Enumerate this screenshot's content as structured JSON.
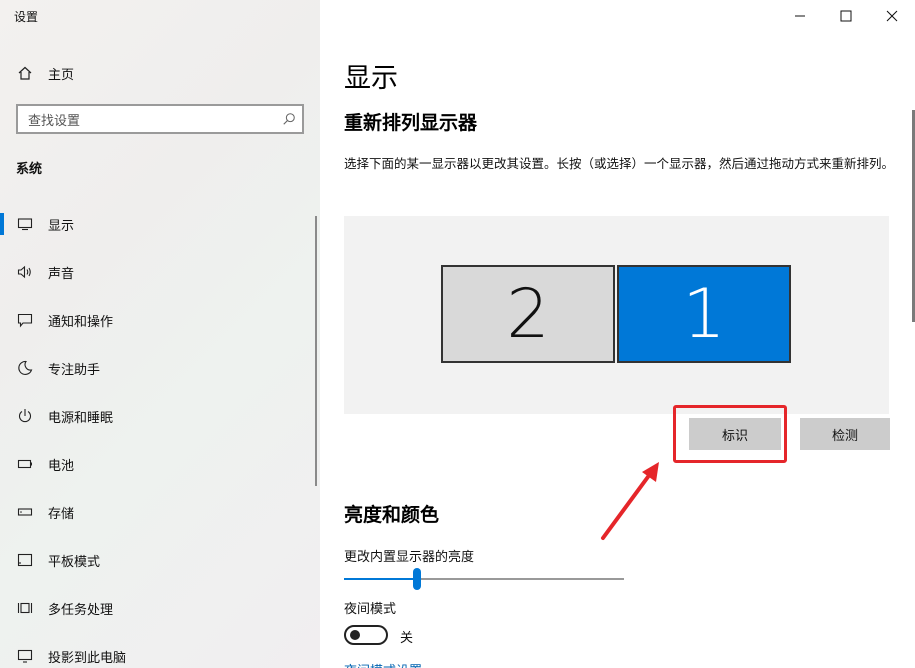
{
  "app": {
    "title": "设置"
  },
  "sidebar": {
    "home_label": "主页",
    "search_placeholder": "查找设置",
    "section_title": "系统",
    "items": [
      {
        "label": "显示",
        "icon": "monitor-icon",
        "active": true
      },
      {
        "label": "声音",
        "icon": "speaker-icon"
      },
      {
        "label": "通知和操作",
        "icon": "notification-icon"
      },
      {
        "label": "专注助手",
        "icon": "moon-icon"
      },
      {
        "label": "电源和睡眠",
        "icon": "power-icon"
      },
      {
        "label": "电池",
        "icon": "battery-icon"
      },
      {
        "label": "存储",
        "icon": "storage-icon"
      },
      {
        "label": "平板模式",
        "icon": "tablet-icon"
      },
      {
        "label": "多任务处理",
        "icon": "multitask-icon"
      },
      {
        "label": "投影到此电脑",
        "icon": "project-icon"
      }
    ]
  },
  "main": {
    "title": "显示",
    "rearrange_title": "重新排列显示器",
    "description": "选择下面的某一显示器以更改其设置。长按（或选择）一个显示器，然后通过拖动方式来重新排列。",
    "monitors": [
      {
        "number": "2",
        "selected": false
      },
      {
        "number": "1",
        "selected": true
      }
    ],
    "identify_button": "标识",
    "detect_button": "检测",
    "brightness_section": "亮度和颜色",
    "brightness_label": "更改内置显示器的亮度",
    "brightness_value": 0.26,
    "night_mode_label": "夜间模式",
    "night_mode_state": "关",
    "night_mode_link": "夜间模式设置"
  },
  "colors": {
    "accent": "#0078d7",
    "highlight": "#e5262a"
  }
}
